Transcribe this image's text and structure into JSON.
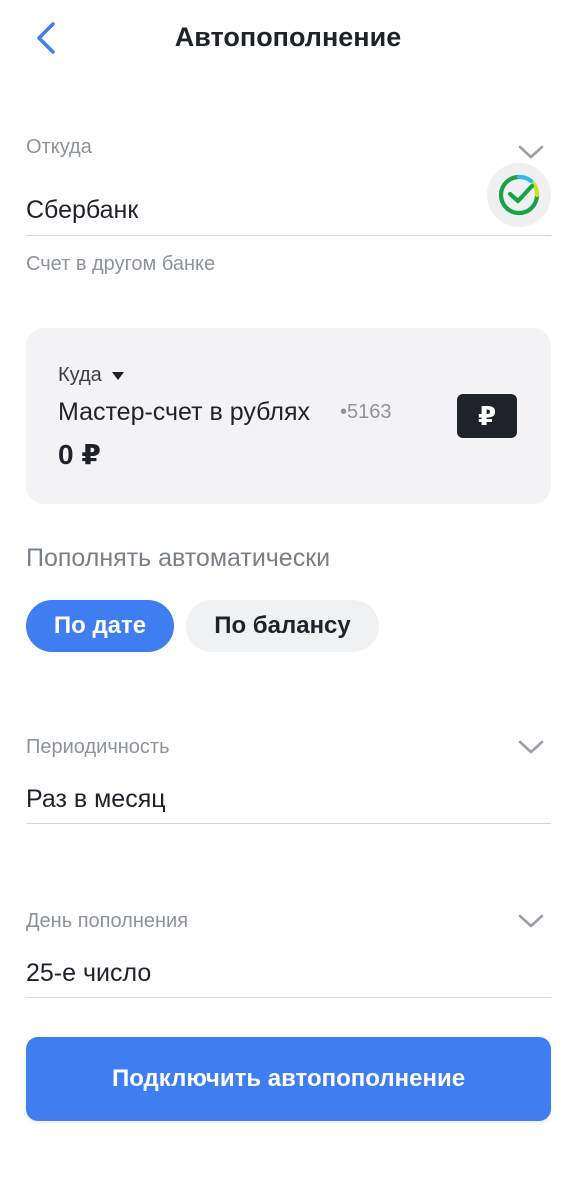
{
  "header": {
    "title": "Автопополнение",
    "back_icon": "chevron-left-icon"
  },
  "from": {
    "label": "Откуда",
    "value": "Сбербанк",
    "hint": "Счет в другом банке",
    "bank_logo": "sberbank-logo",
    "dropdown_icon": "chevron-down-icon"
  },
  "to": {
    "label": "Куда",
    "account_name": "Мастер-счет в рублях",
    "account_mask": "•5163",
    "balance": "0 ₽",
    "currency_badge": "₽"
  },
  "auto": {
    "title": "Пополнять автоматически",
    "options": [
      {
        "label": "По дате",
        "selected": true
      },
      {
        "label": "По балансу",
        "selected": false
      }
    ]
  },
  "periodicity": {
    "label": "Периодичность",
    "value": "Раз в месяц"
  },
  "topup_day": {
    "label": "День пополнения",
    "value": "25-е число"
  },
  "action": {
    "label": "Подключить автопополнение"
  },
  "colors": {
    "accent": "#3f7ef0",
    "text": "#1f2229",
    "muted": "#8e9399",
    "card_bg": "#f3f3f5"
  }
}
